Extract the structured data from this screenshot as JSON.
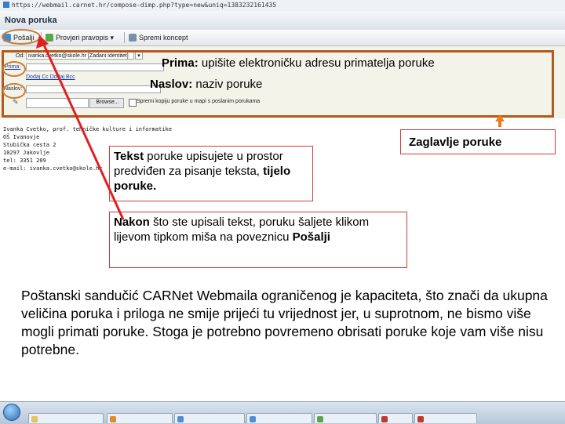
{
  "browser": {
    "url": "https://webmail.carnet.hr/compose-dimp.php?type=new&uniq=1383232161435"
  },
  "window": {
    "title": "Nova poruka"
  },
  "toolbar": {
    "send": "Pošalji",
    "spell": "Provjeri pravopis",
    "draft": "Spremi koncept"
  },
  "header": {
    "from_label": "Od:",
    "from_value": "ivanka.cvetko@skole.hr [Zadani identitet]",
    "to_label": "Prima:",
    "cc_links": "Dodaj Cc  Dodaj Bcc",
    "subject_label": "Naslov:",
    "browse_button": "Browse...",
    "save_sent_label": "Spremi kopiju poruke u mapi s poslanim porukama"
  },
  "signature": [
    "Ivanka Cvetko, prof. tehničke kulture i informatike",
    "OŠ Ivanovje",
    "Stubička cesta 2",
    "10297 Jakovlje",
    "tel: 3351 209",
    "e-mail: ivanka.cvetko@skole.hr"
  ],
  "annotations": {
    "prima_bold": "Prima:",
    "prima_text": " upišite elektroničku adresu primatelja poruke",
    "naslov_bold": "Naslov:",
    "naslov_text": " naziv poruke",
    "zaglavlje": "Zaglavlje poruke",
    "tekst_bold": "Tekst",
    "tekst_text1": " poruke upisujete u prostor predviđen za pisanje teksta, ",
    "tekst_bold2": "tijelo poruke.",
    "nakon_bold": "Nakon",
    "nakon_text": " što ste upisali tekst, poruku šaljete klikom lijevom tipkom miša na poveznicu ",
    "nakon_bold2": "Pošalji"
  },
  "paragraph": "Poštanski sandučić CARNet Webmaila ograničenog je kapaciteta, što znači da ukupna veličina poruka i priloga ne smije prijeći tu vrijednost jer, u suprotnom, ne bismo više mogli primati poruke. Stoga je potrebno povremeno obrisati poruke koje vam više nisu potrebne.",
  "colors": {
    "frame": "#b35a1f",
    "arrow": "#e02020",
    "up_arrow": "#f07a1a",
    "callout_border": "#d43a3a",
    "highlight_circle": "#c8803a"
  },
  "icons": [
    "send-icon",
    "spellcheck-icon",
    "draft-icon",
    "attachment-icon",
    "start-orb-icon"
  ]
}
